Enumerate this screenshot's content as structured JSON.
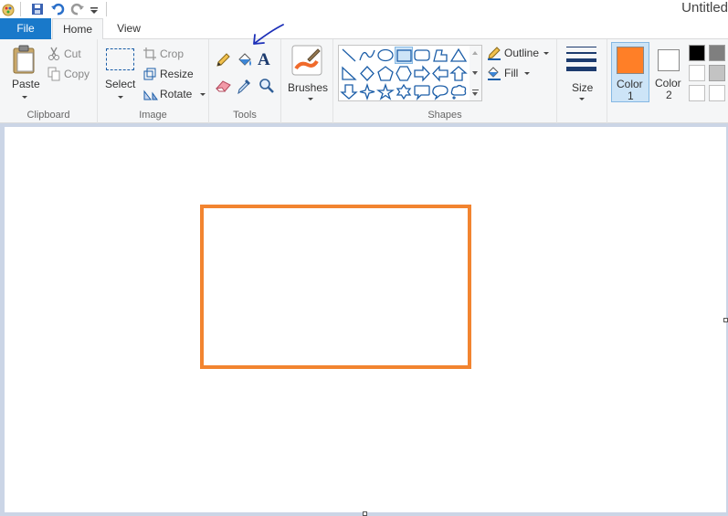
{
  "window": {
    "title": "Untitled"
  },
  "tabs": {
    "file": "File",
    "home": "Home",
    "view": "View"
  },
  "clipboard": {
    "paste": "Paste",
    "cut": "Cut",
    "copy": "Copy",
    "group": "Clipboard"
  },
  "image": {
    "select": "Select",
    "crop": "Crop",
    "resize": "Resize",
    "rotate": "Rotate",
    "group": "Image"
  },
  "tools": {
    "group": "Tools"
  },
  "brushes": {
    "label": "Brushes"
  },
  "shapes": {
    "group": "Shapes",
    "outline": "Outline",
    "fill": "Fill"
  },
  "size": {
    "label": "Size"
  },
  "colors": {
    "color1_line1": "Color",
    "color1_line2": "1",
    "color2_line1": "Color",
    "color2_line2": "2",
    "color1_value": "#ff7f27",
    "color2_value": "#ffffff",
    "palette": [
      "#000000",
      "#7f7f7f",
      "#ffffff",
      "#c3c3c3",
      "#ffffff",
      "#ffffff"
    ]
  },
  "drawing": {
    "rectangle_stroke": "#f28430"
  },
  "annotation": {
    "arrow_color": "#1c2fb8"
  }
}
